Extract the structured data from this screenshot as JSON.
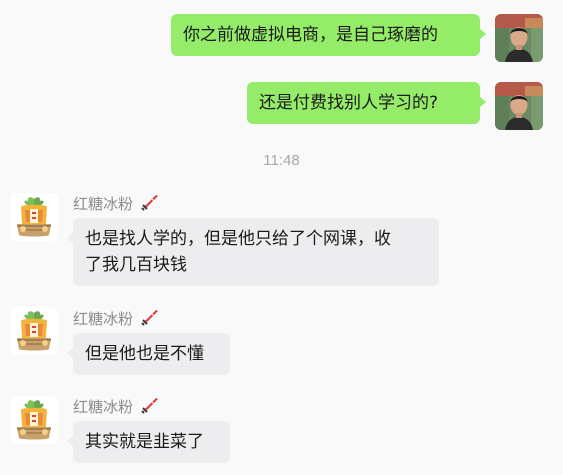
{
  "messages": {
    "m1": {
      "text": "你之前做虚拟电商，是自己琢磨的"
    },
    "m2": {
      "text": "还是付费找别人学习的?"
    },
    "m3": {
      "sender": "红糖冰粉",
      "line1": "也是找人学的，但是他只给了个网课，收",
      "line2": "了我几百块钱"
    },
    "m4": {
      "sender": "红糖冰粉",
      "text": "但是他也是不懂"
    },
    "m5": {
      "sender": "红糖冰粉",
      "text": "其实就是韭菜了"
    }
  },
  "timestamp": "11:48",
  "icons": {
    "sender_badge": "sword-icon",
    "self_avatar": "user-photo-avatar",
    "contact_avatar": "mascot-avatar"
  },
  "colors": {
    "outgoing_bubble": "#95ec69",
    "incoming_bubble": "#ededf0",
    "background": "#f9f9fa",
    "meta_text": "#a8a8a8"
  }
}
